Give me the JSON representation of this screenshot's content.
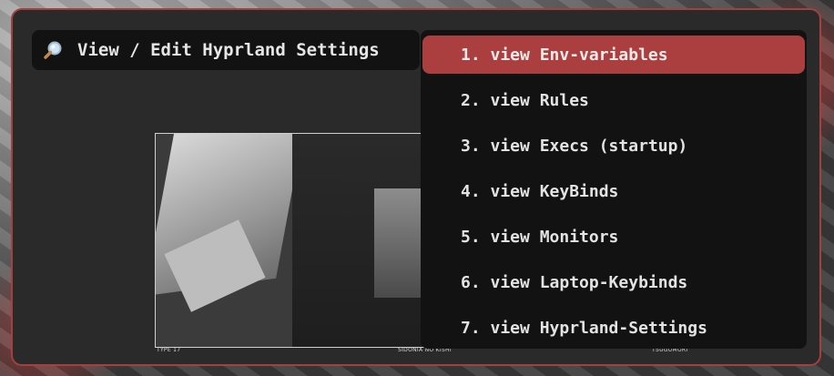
{
  "search": {
    "icon": "search-icon",
    "title": "View / Edit Hyprland Settings"
  },
  "results": {
    "selected_index": 0,
    "accent_color": "#ab3f3f",
    "items": [
      {
        "label": "1. view Env-variables"
      },
      {
        "label": "2. view Rules"
      },
      {
        "label": "3. view Execs (startup)"
      },
      {
        "label": "4. view KeyBinds"
      },
      {
        "label": "5. view Monitors"
      },
      {
        "label": "6. view Laptop-Keybinds"
      },
      {
        "label": "7. view Hyprland-Settings"
      }
    ]
  },
  "preview": {
    "caption_left": "TYPE 17",
    "caption_mid": "SIDONIA NO KISHI",
    "caption_right": "TSUGUMORI"
  },
  "colors": {
    "window_border": "#a34040",
    "window_bg": "#2a2a2a",
    "panel_bg": "#121212"
  }
}
